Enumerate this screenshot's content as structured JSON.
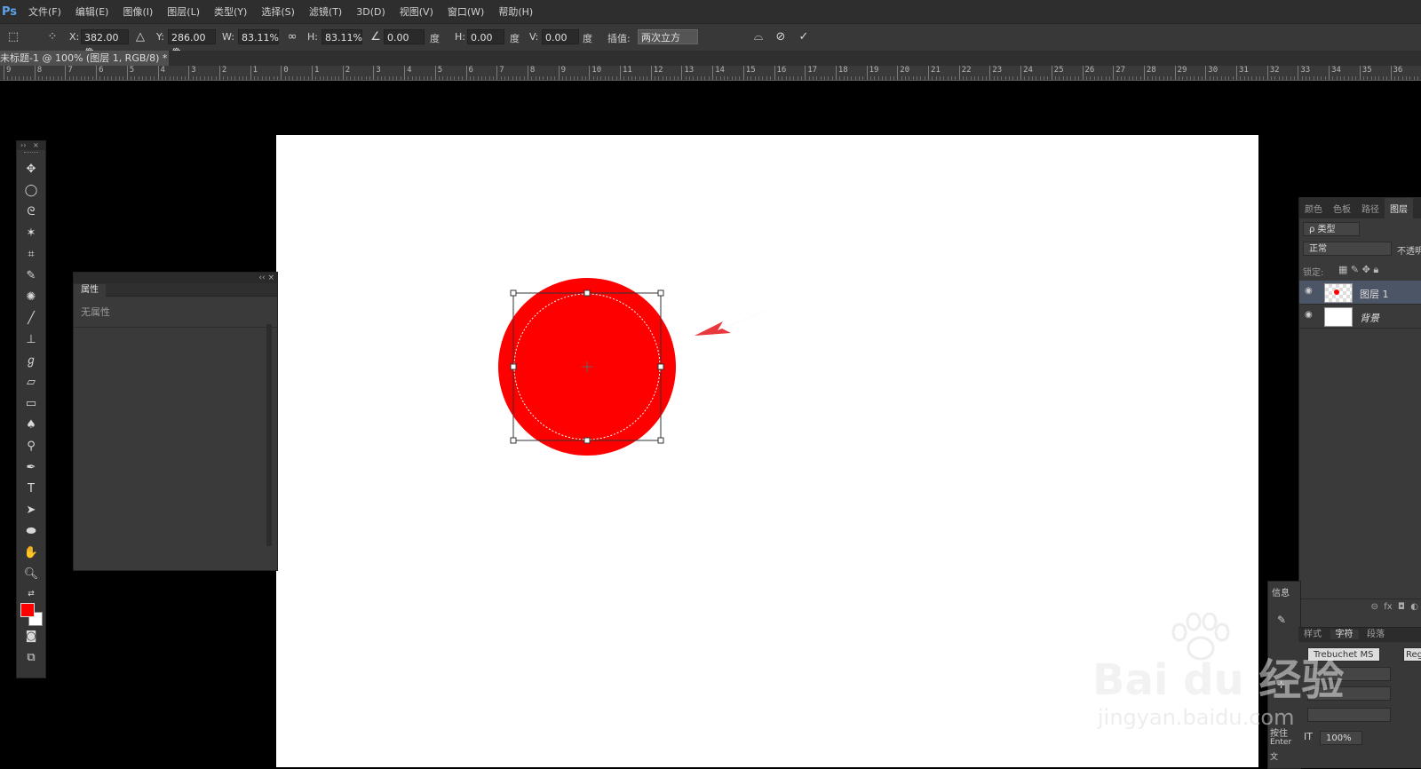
{
  "app": {
    "logo": "Ps"
  },
  "menu": [
    "文件(F)",
    "编辑(E)",
    "图像(I)",
    "图层(L)",
    "类型(Y)",
    "选择(S)",
    "滤镜(T)",
    "3D(D)",
    "视图(V)",
    "窗口(W)",
    "帮助(H)"
  ],
  "options": {
    "x_label": "X:",
    "x_value": "382.00 像",
    "y_label": "Y:",
    "y_value": "286.00 像",
    "w_label": "W:",
    "w_value": "83.11%",
    "h_label": "H:",
    "h_value": "83.11%",
    "angle_value": "0.00",
    "angle_unit": "度",
    "hskew_label": "H:",
    "hskew_value": "0.00",
    "hskew_unit": "度",
    "vskew_label": "V:",
    "vskew_value": "0.00",
    "vskew_unit": "度",
    "interp_label": "插值:",
    "interp_value": "两次立方"
  },
  "document": {
    "tab_title": "未标题-1 @ 100% (图层 1, RGB/8) *",
    "tab_close": "×"
  },
  "ruler": {
    "labels": [
      "9",
      "8",
      "7",
      "6",
      "5",
      "4",
      "3",
      "2",
      "1",
      "0",
      "1",
      "2",
      "3",
      "4",
      "5",
      "6",
      "7",
      "8",
      "9",
      "10",
      "11",
      "12",
      "13",
      "14",
      "15",
      "16",
      "17",
      "18",
      "19",
      "20",
      "21",
      "22",
      "23",
      "24",
      "25",
      "26",
      "27",
      "28",
      "29",
      "30",
      "31",
      "32",
      "33",
      "34",
      "35",
      "36"
    ]
  },
  "toolbox": {
    "foreground_color": "#ff0000",
    "background_color": "#ffffff"
  },
  "properties_panel": {
    "tab": "属性",
    "empty_text": "无属性"
  },
  "layers_panel": {
    "tabs": [
      "颜色",
      "色板",
      "路径",
      "图层"
    ],
    "filter_label": "ρ 类型",
    "blend_mode": "正常",
    "opacity_label": "不透明",
    "lock_label": "锁定:",
    "layers": [
      {
        "name": "图层 1",
        "selected": true
      },
      {
        "name": "背景",
        "selected": false
      }
    ]
  },
  "info_panel": {
    "tab": "信息"
  },
  "character_panel": {
    "tabs": [
      "样式",
      "字符",
      "段落"
    ],
    "font": "Trebuchet MS",
    "style": "Reg",
    "scale": "100%",
    "hint_a": "按住",
    "hint_b": "Enter",
    "hint_c": "文"
  },
  "shape": {
    "color": "#ff0000"
  },
  "watermark": {
    "brand": "Bai du 经验",
    "url": "jingyan.baidu.com"
  }
}
